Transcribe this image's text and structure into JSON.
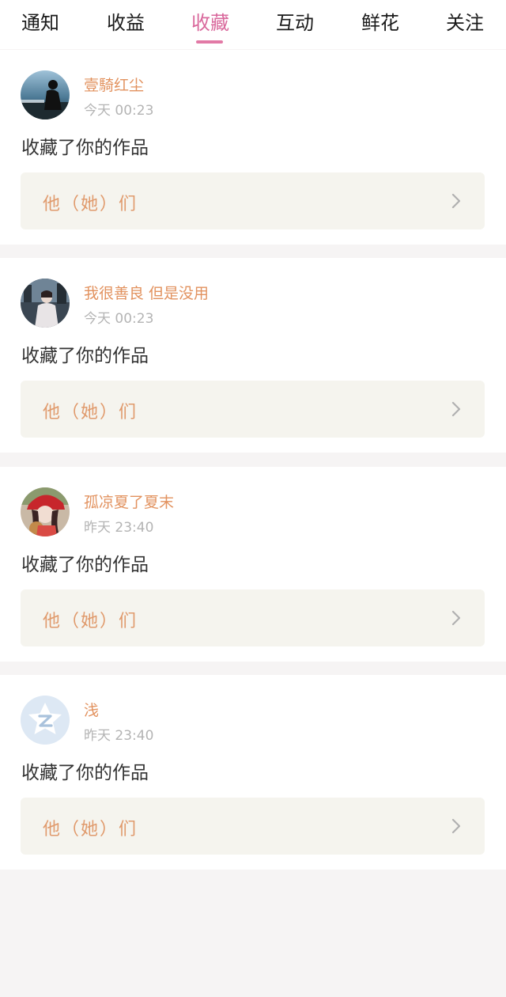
{
  "tabs": [
    {
      "label": "通知"
    },
    {
      "label": "收益"
    },
    {
      "label": "收藏"
    },
    {
      "label": "互动"
    },
    {
      "label": "鲜花"
    },
    {
      "label": "关注"
    }
  ],
  "active_tab": "收藏",
  "notifications": [
    {
      "name": "壹騎红尘",
      "time": "今天 00:23",
      "action": "收藏了你的作品",
      "button_label": "他（她）们"
    },
    {
      "name": "我很善良 但是没用",
      "time": "今天 00:23",
      "action": "收藏了你的作品",
      "button_label": "他（她）们"
    },
    {
      "name": "孤凉夏了夏末",
      "time": "昨天 23:40",
      "action": "收藏了你的作品",
      "button_label": "他（她）们"
    },
    {
      "name": "浅",
      "time": "昨天 23:40",
      "action": "收藏了你的作品",
      "button_label": "他（她）们"
    }
  ],
  "colors": {
    "accent": "#d9689c",
    "username": "#e2925f",
    "button_text": "#e09a6c",
    "page_background": "#f6f4f4"
  },
  "icons": {
    "row_arrow": "chevron-right-icon",
    "default_avatar": "qzone-star-avatar"
  }
}
